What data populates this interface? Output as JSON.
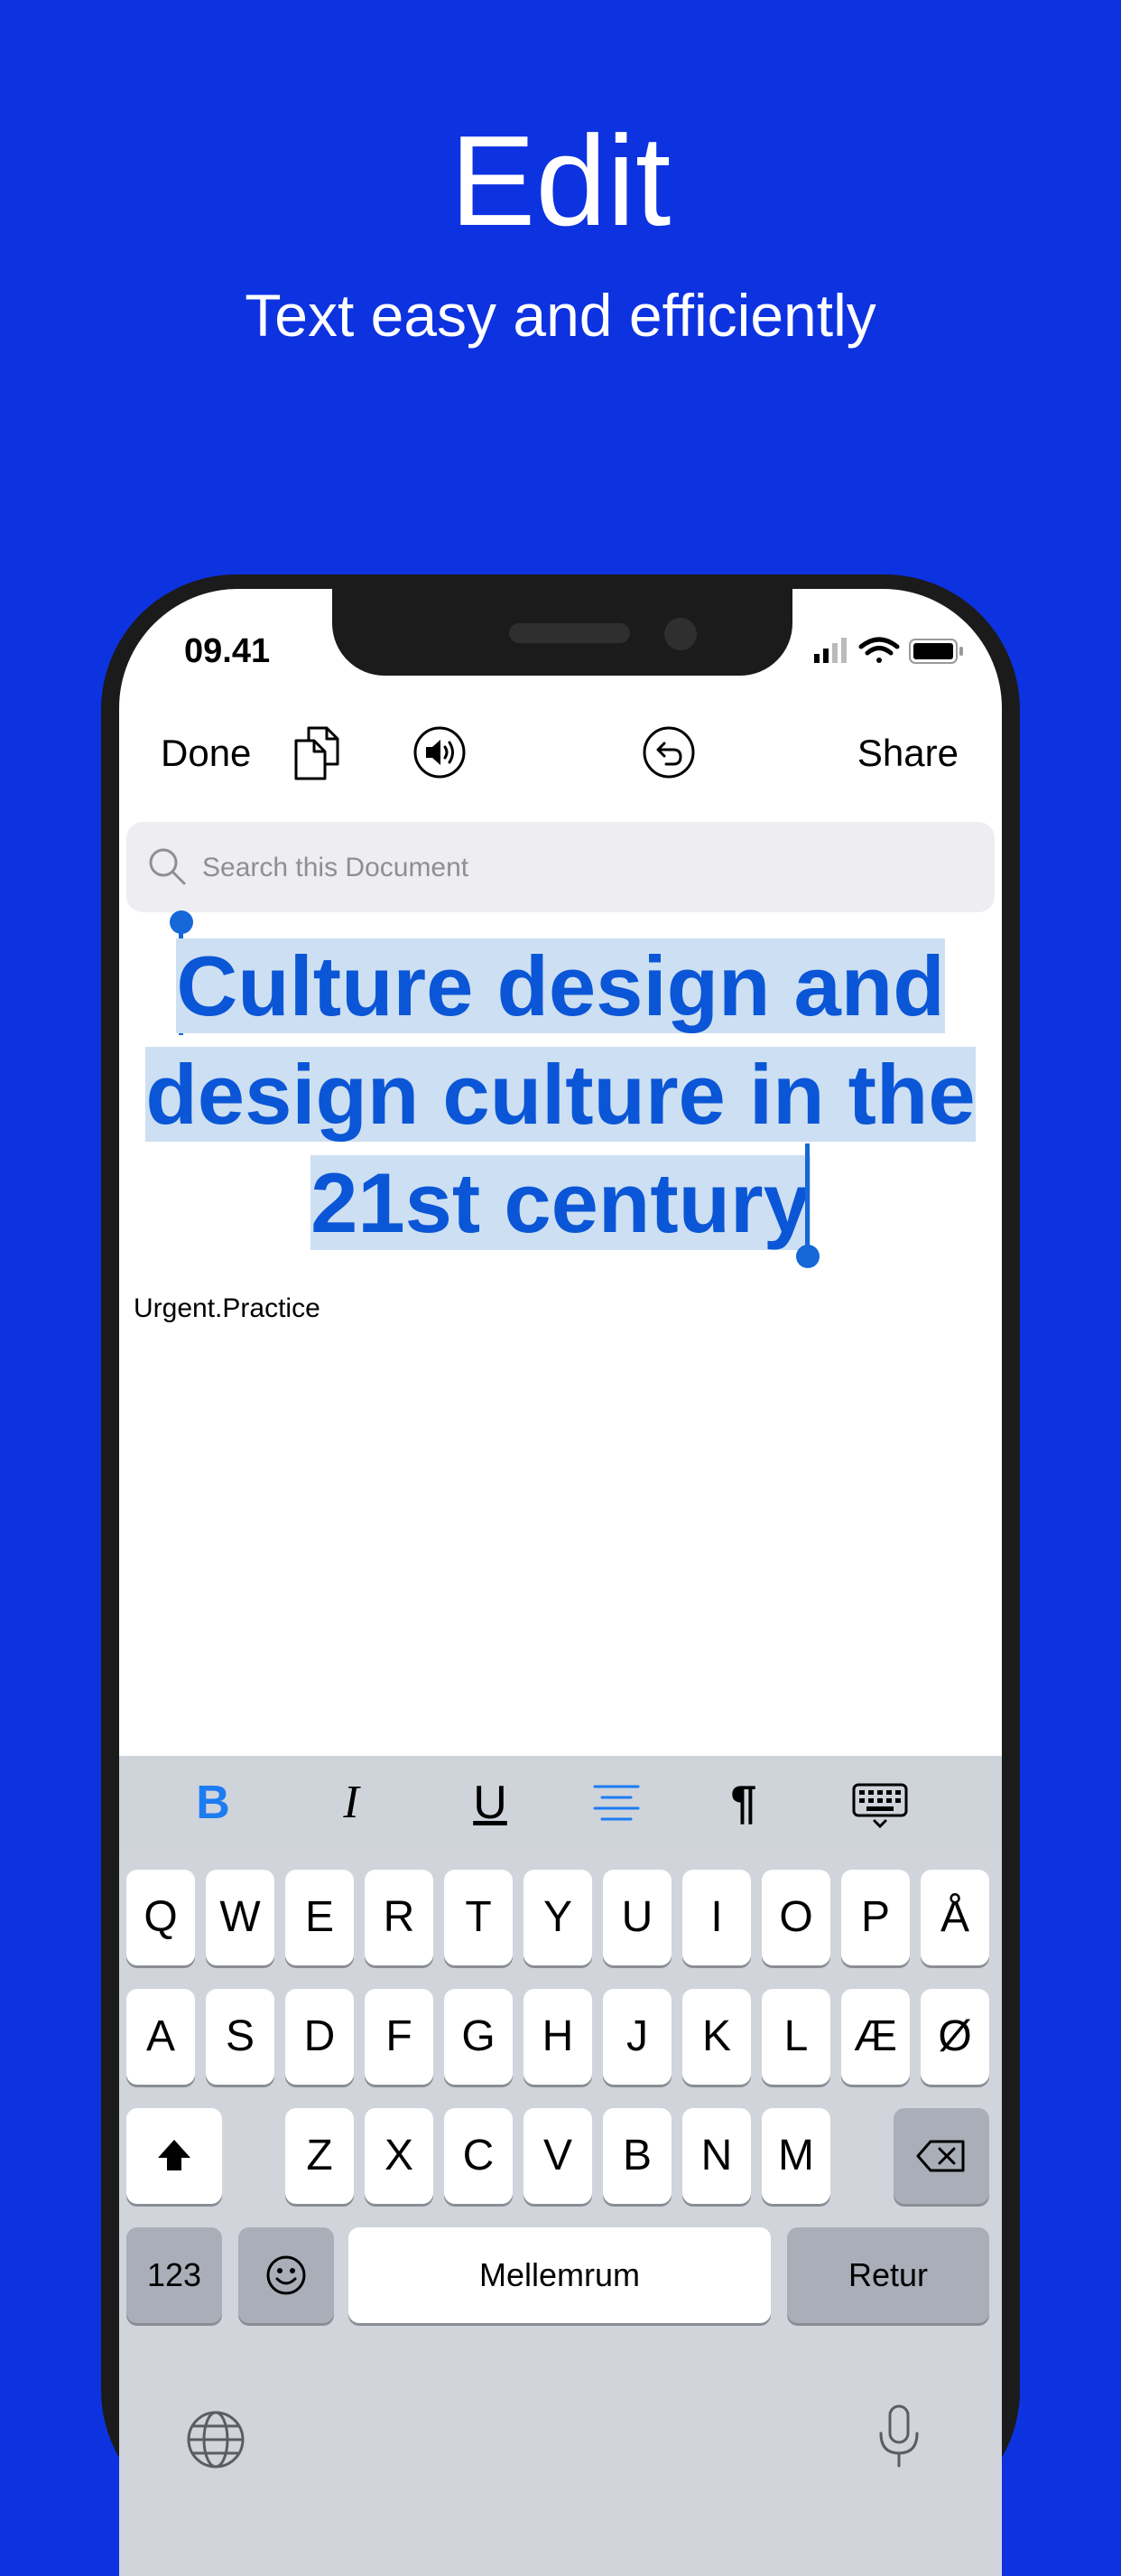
{
  "promo": {
    "title": "Edit",
    "subtitle": "Text easy and efficiently"
  },
  "status_bar": {
    "time": "09.41"
  },
  "toolbar": {
    "done_label": "Done",
    "share_label": "Share"
  },
  "search": {
    "placeholder": "Search this Document"
  },
  "document": {
    "title_lines": [
      "Culture design and",
      "design culture in the",
      "21st century"
    ],
    "body_text": "Urgent.Practice"
  },
  "format_bar": {
    "bold": "B",
    "italic": "I",
    "underline": "U",
    "paragraph": "¶"
  },
  "keyboard": {
    "row1": [
      "Q",
      "W",
      "E",
      "R",
      "T",
      "Y",
      "U",
      "I",
      "O",
      "P",
      "Å"
    ],
    "row2": [
      "A",
      "S",
      "D",
      "F",
      "G",
      "H",
      "J",
      "K",
      "L",
      "Æ",
      "Ø"
    ],
    "row3": [
      "Z",
      "X",
      "C",
      "V",
      "B",
      "N",
      "M"
    ],
    "numbers_label": "123",
    "space_label": "Mellemrum",
    "return_label": "Retur"
  },
  "colors": {
    "background": "#0d32e0",
    "accent": "#0a56d6",
    "selection": "#cddff2"
  }
}
